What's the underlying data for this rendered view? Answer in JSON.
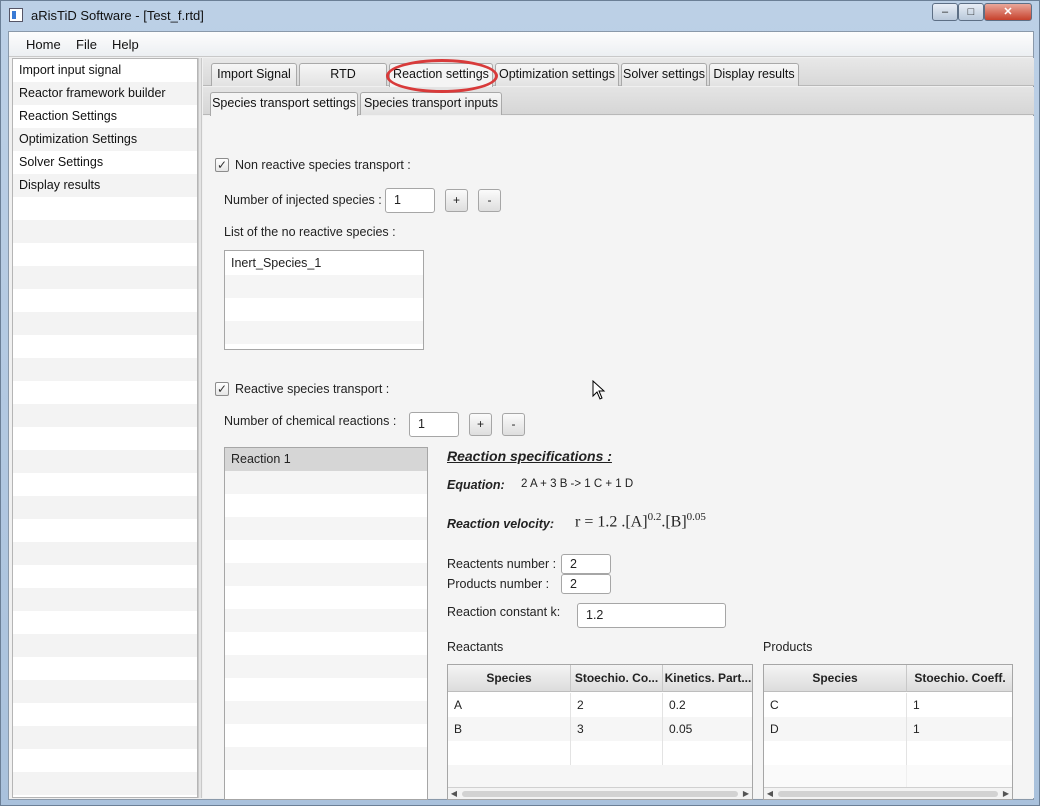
{
  "window": {
    "title": "aRisTiD Software - [Test_f.rtd]",
    "min_label": "‒",
    "max_label": "□",
    "close_label": "✕"
  },
  "menu": [
    {
      "label": "Home"
    },
    {
      "label": "File"
    },
    {
      "label": "Help"
    }
  ],
  "sidebar": {
    "items": [
      {
        "label": "Import input signal"
      },
      {
        "label": "Reactor framework builder"
      },
      {
        "label": "Reaction Settings"
      },
      {
        "label": "Optimization Settings"
      },
      {
        "label": "Solver Settings"
      },
      {
        "label": "Display results"
      }
    ]
  },
  "tabs": [
    {
      "label": "Import Signal"
    },
    {
      "label": "RTD framework"
    },
    {
      "label": "Reaction settings"
    },
    {
      "label": "Optimization settings"
    },
    {
      "label": "Solver settings"
    },
    {
      "label": "Display results"
    }
  ],
  "subtabs": [
    {
      "label": "Species transport settings"
    },
    {
      "label": "Species transport inputs"
    }
  ],
  "nonreactive": {
    "label": "Non reactive species transport :",
    "checked_mark": "✓",
    "count_label": "Number of injected species :",
    "count_value": "1",
    "plus": "+",
    "minus": "-",
    "list_label": "List of the no reactive species :",
    "species": [
      "Inert_Species_1"
    ]
  },
  "reactive": {
    "label": "Reactive species transport :",
    "checked_mark": "✓",
    "count_label": "Number of chemical reactions :",
    "count_value": "1",
    "plus": "+",
    "minus": "-",
    "reactions": [
      "Reaction 1"
    ]
  },
  "spec": {
    "title": "Reaction specifications :",
    "equation_label": "Equation:",
    "equation": "2 A + 3 B  ->  1 C + 1 D",
    "velocity_label": "Reaction velocity:",
    "velocity_prefix": "r = 1.2 .[A]",
    "velocity_exp_a": "0.2",
    "velocity_mid": ".[B]",
    "velocity_exp_b": "0.05",
    "reactants_number_label": "Reactents number :",
    "reactants_number": "2",
    "products_number_label": "Products number :",
    "products_number": "2",
    "constant_label": "Reaction constant k:",
    "constant_value": "1.2"
  },
  "reactants": {
    "title": "Reactants",
    "columns": [
      "Species",
      "Stoechio. Co...",
      "Kinetics. Part..."
    ],
    "rows": [
      [
        "A",
        "2",
        "0.2"
      ],
      [
        "B",
        "3",
        "0.05"
      ]
    ]
  },
  "products": {
    "title": "Products",
    "columns": [
      "Species",
      "Stoechio. Coeff."
    ],
    "rows": [
      [
        "C",
        "1"
      ],
      [
        "D",
        "1"
      ]
    ]
  }
}
